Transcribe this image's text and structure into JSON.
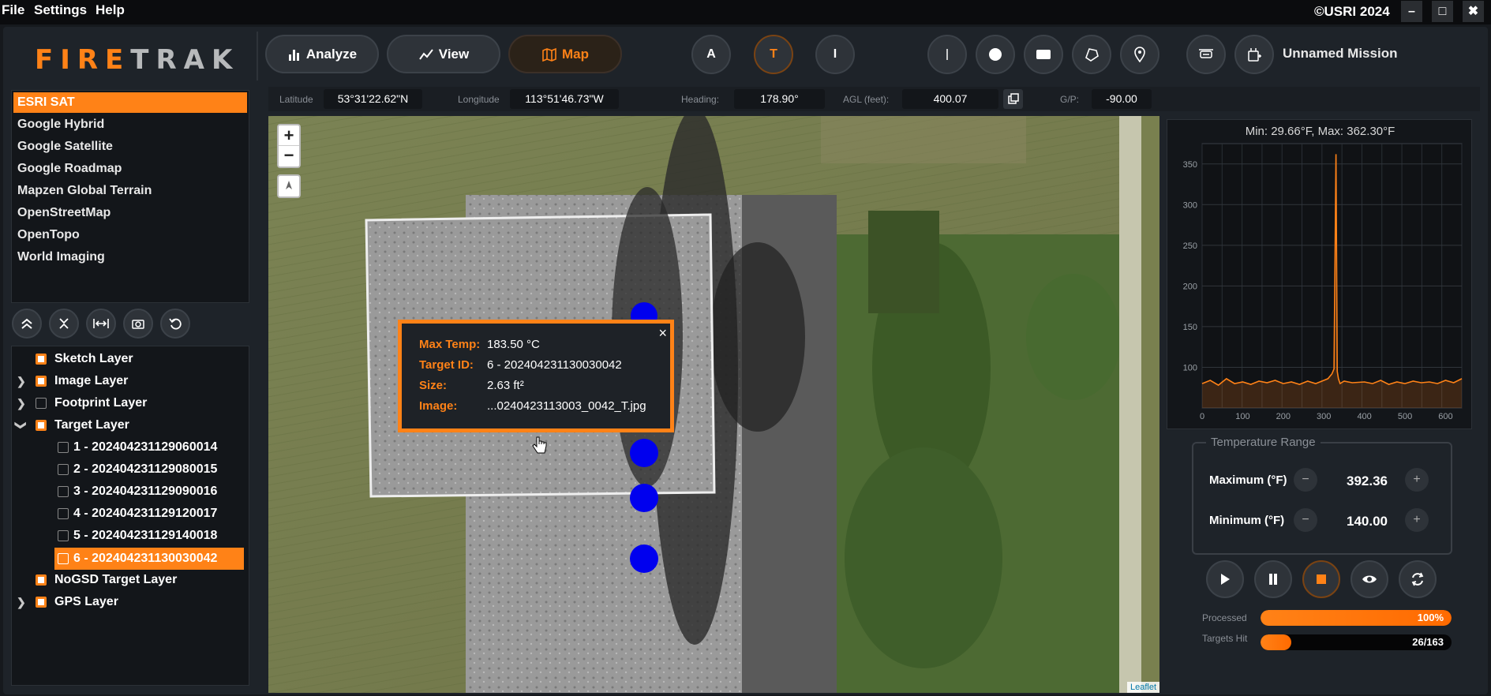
{
  "menu": {
    "file": "File",
    "settings": "Settings",
    "help": "Help",
    "copyright": "©USRI 2024"
  },
  "window": {
    "minimize": "–",
    "maximize": "□",
    "close": "✖"
  },
  "logo": {
    "fire": "FIRE",
    "trak": "TRAK"
  },
  "toolbar": {
    "analyze": "Analyze",
    "view": "View",
    "map": "Map",
    "mode_a": "A",
    "mode_t": "T",
    "mode_i": "I",
    "mission": "Unnamed Mission"
  },
  "coords": {
    "latitude_label": "Latitude",
    "latitude": "53°31'22.62\"N",
    "longitude_label": "Longitude",
    "longitude": "113°51'46.73\"W",
    "heading_label": "Heading:",
    "heading": "178.90°",
    "agl_label": "AGL (feet):",
    "agl": "400.07",
    "gp_label": "G/P:",
    "gp": "-90.00"
  },
  "basemaps": [
    "ESRI SAT",
    "Google Hybrid",
    "Google Satellite",
    "Google Roadmap",
    "Mapzen Global Terrain",
    "OpenStreetMap",
    "OpenTopo",
    "World Imaging"
  ],
  "layers": {
    "sketch": "Sketch Layer",
    "image": "Image Layer",
    "footprint": "Footprint Layer",
    "target": "Target Layer",
    "targets": [
      "1 - 202404231129060014",
      "2 - 202404231129080015",
      "3 - 202404231129090016",
      "4 - 202404231129120017",
      "5 - 202404231129140018",
      "6 - 202404231130030042"
    ],
    "nogsd": "NoGSD Target Layer",
    "gps": "GPS Layer"
  },
  "map": {
    "zoom_in": "+",
    "zoom_out": "−",
    "attribution": "Leaflet"
  },
  "popup": {
    "max_temp_label": "Max Temp:",
    "max_temp": "183.50 °C",
    "target_id_label": "Target ID:",
    "target_id": "6 - 202404231130030042",
    "size_label": "Size:",
    "size": "2.63 ft²",
    "image_label": "Image:",
    "image": "...0240423113003_0042_T.jpg",
    "close": "×"
  },
  "chart_data": {
    "type": "line",
    "title": "Min: 29.66°F, Max: 362.30°F",
    "xlabel": "",
    "ylabel": "",
    "xlim": [
      0,
      640
    ],
    "ylim": [
      50,
      375
    ],
    "x_ticks": [
      0,
      100,
      200,
      300,
      400,
      500,
      600
    ],
    "y_ticks": [
      100,
      150,
      200,
      250,
      300,
      350
    ],
    "grid": true,
    "series": [
      {
        "x": [
          0,
          20,
          40,
          60,
          80,
          100,
          120,
          140,
          160,
          180,
          200,
          220,
          240,
          260,
          280,
          300,
          310,
          320,
          325,
          330,
          333,
          336,
          340,
          350,
          370,
          400,
          420,
          440,
          460,
          480,
          500,
          520,
          540,
          560,
          580,
          600,
          620,
          640
        ],
        "y": [
          80,
          84,
          78,
          86,
          80,
          82,
          79,
          83,
          81,
          84,
          80,
          82,
          79,
          83,
          80,
          84,
          86,
          92,
          98,
          362,
          95,
          86,
          80,
          83,
          81,
          82,
          80,
          84,
          79,
          82,
          80,
          83,
          81,
          82,
          80,
          84,
          81,
          86
        ]
      }
    ],
    "color": "#ff8217"
  },
  "temp_range": {
    "legend": "Temperature Range",
    "max_label": "Maximum (°F)",
    "max": "392.36",
    "min_label": "Minimum (°F)",
    "min": "140.00",
    "minus": "−",
    "plus": "+"
  },
  "progress": {
    "processed_label": "Processed",
    "processed": "100%",
    "processed_fraction": 1.0,
    "targets_label": "Targets Hit",
    "targets": "26/163",
    "targets_fraction": 0.16
  },
  "colors": {
    "accent": "#ff8217",
    "marker": "#0000ee"
  }
}
